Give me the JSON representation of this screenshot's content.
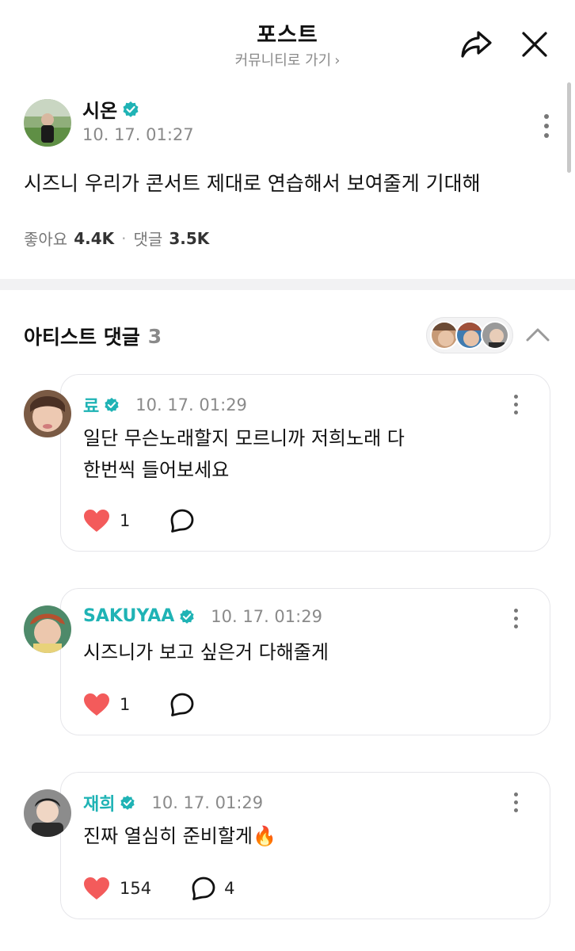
{
  "header": {
    "title": "포스트",
    "community_link": "커뮤니티로 가기",
    "chevron": "›"
  },
  "post": {
    "author": "시온",
    "verified_icon": "verified-badge-icon",
    "time": "10. 17. 01:27",
    "body": "시즈니 우리가 콘서트 제대로 연습해서 보여줄게 기대해",
    "likes_label": "좋아요",
    "likes": "4.4K",
    "separator": "·",
    "comments_label": "댓글",
    "comments": "3.5K"
  },
  "artist_comments": {
    "title": "아티스트 댓글",
    "count": "3",
    "items": [
      {
        "name": "료",
        "time": "10. 17. 01:29",
        "text_lines": [
          "일단 무슨노래할지 모르니까 저희노래 다",
          "한번씩 들어보세요"
        ],
        "likes": "1",
        "replies": ""
      },
      {
        "name": "SAKUYAA",
        "time": "10. 17. 01:29",
        "text_lines": [
          "시즈니가 보고 싶은거 다해줄게"
        ],
        "likes": "1",
        "replies": ""
      },
      {
        "name": "재희",
        "time": "10. 17. 01:29",
        "text_lines": [
          "진짜 열심히 준비할게🔥"
        ],
        "likes": "154",
        "replies": "4"
      }
    ]
  },
  "colors": {
    "accent": "#1fb3b5",
    "verified": "#1fb3b5",
    "heart": "#f35b5b",
    "muted": "#8a8a8a"
  }
}
